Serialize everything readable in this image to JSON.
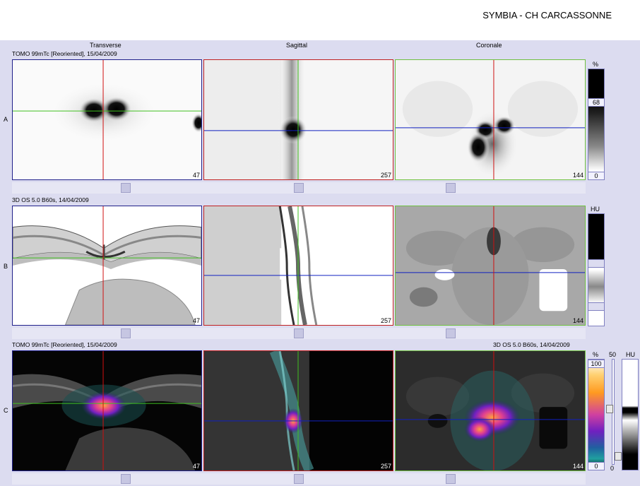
{
  "header": {
    "title": "SYMBIA - CH CARCASSONNE"
  },
  "columns": {
    "transverse": "Transverse",
    "sagittal": "Sagittal",
    "coronal": "Coronale"
  },
  "rows": {
    "a": {
      "letter": "A",
      "info": "TOMO 99mTc [Reoriented], 15/04/2009"
    },
    "b": {
      "letter": "B",
      "info": "3D  OS  5.0  B60s, 14/04/2009"
    },
    "c": {
      "letter": "C",
      "info_left": "TOMO 99mTc [Reoriented], 15/04/2009",
      "info_right": "3D  OS  5.0  B60s, 14/04/2009"
    }
  },
  "slices": {
    "transverse": "47",
    "sagittal": "257",
    "coronal": "144"
  },
  "scales": {
    "a": {
      "unit": "%",
      "value": "68",
      "min": "0"
    },
    "b": {
      "unit": "HU"
    },
    "c": {
      "unit_pct": "%",
      "max": "100",
      "min": "0",
      "slider_max": "50",
      "slider_min": "0",
      "unit_hu": "HU"
    }
  },
  "colors": {
    "crosshair_red": "#d01010",
    "crosshair_green": "#40c020",
    "crosshair_blue": "#1020c0",
    "border_transverse": "#20208a",
    "border_sagittal": "#c02020",
    "border_coronal": "#70c040"
  }
}
